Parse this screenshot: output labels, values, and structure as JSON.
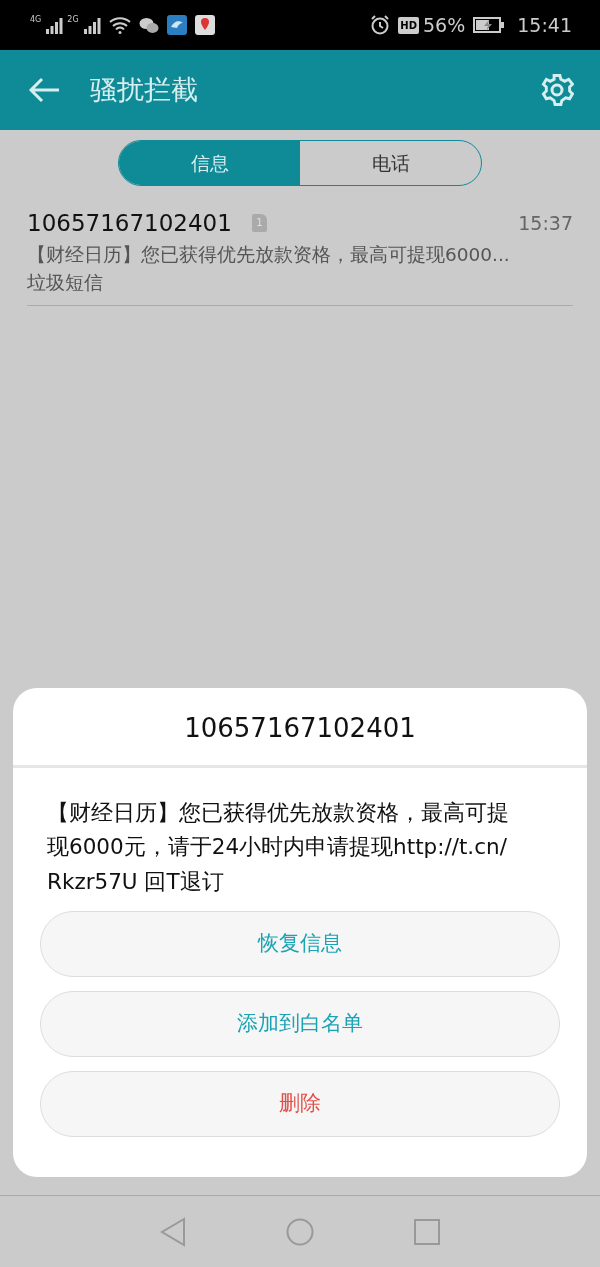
{
  "status_bar": {
    "network_labels": [
      "4G",
      "2G"
    ],
    "hd": "HD",
    "battery": "56%",
    "time": "15:41"
  },
  "header": {
    "title": "骚扰拦截"
  },
  "tabs": [
    {
      "label": "信息",
      "selected": true
    },
    {
      "label": "电话",
      "selected": false
    }
  ],
  "messages": [
    {
      "sender": "10657167102401",
      "sim": "1",
      "time": "15:37",
      "preview": "【财经日历】您已获得优先放款资格，最高可提现6000...",
      "category": "垃圾短信"
    }
  ],
  "dialog": {
    "title": "10657167102401",
    "body": "【财经日历】您已获得优先放款资格，最高可提现6000元，请于24小时内申请提现http://t.cn/Rkzr57U 回T退订",
    "buttons": [
      {
        "label": "恢复信息",
        "kind": "normal"
      },
      {
        "label": "添加到白名单",
        "kind": "normal"
      },
      {
        "label": "删除",
        "kind": "danger"
      }
    ]
  }
}
